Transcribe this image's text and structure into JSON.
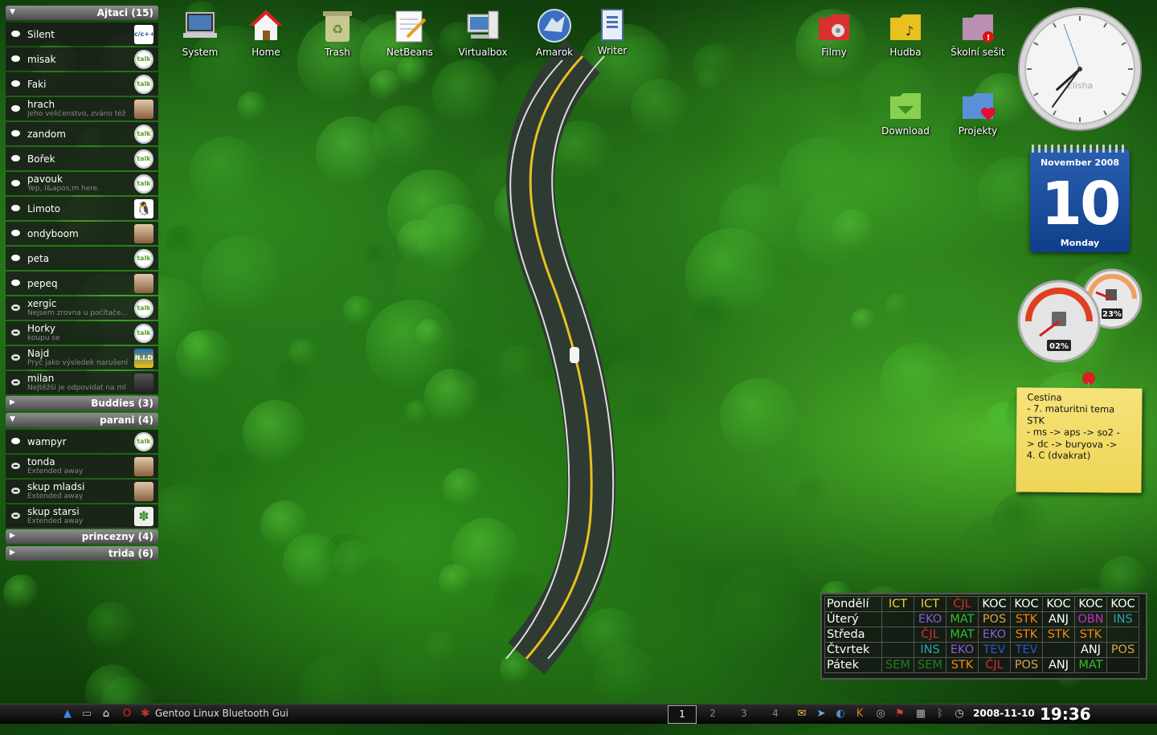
{
  "contacts": {
    "groups": [
      {
        "title": "Ajtaci (15)",
        "expanded": true,
        "contacts": [
          {
            "name": "Silent",
            "status_msg": "",
            "avatar": "c/c++",
            "away": false
          },
          {
            "name": "misak",
            "status_msg": "",
            "avatar": "talk",
            "away": false
          },
          {
            "name": "Faki",
            "status_msg": "",
            "avatar": "talk",
            "away": false
          },
          {
            "name": "hrach",
            "status_msg": "Jeho veličenstvo, zváno též",
            "avatar": "face",
            "away": false
          },
          {
            "name": "zandom",
            "status_msg": "",
            "avatar": "talk",
            "away": false
          },
          {
            "name": "Bořek",
            "status_msg": "",
            "avatar": "talk",
            "away": false
          },
          {
            "name": "pavouk",
            "status_msg": "Yep, I&apos;m here.",
            "avatar": "talk",
            "away": false
          },
          {
            "name": "Limoto",
            "status_msg": "",
            "avatar": "tux",
            "away": false
          },
          {
            "name": "ondyboom",
            "status_msg": "",
            "avatar": "face",
            "away": false
          },
          {
            "name": "peta",
            "status_msg": "",
            "avatar": "talk",
            "away": false
          },
          {
            "name": "pepeq",
            "status_msg": "",
            "avatar": "face",
            "away": false
          },
          {
            "name": "xergic",
            "status_msg": "Nejsem zrovna u počítače...",
            "avatar": "talk",
            "away": true
          },
          {
            "name": "Horky",
            "status_msg": "koupu se",
            "avatar": "talk",
            "away": true
          },
          {
            "name": "Najd",
            "status_msg": "Pryč jako výsledek narušení",
            "avatar": "N.I.D",
            "away": true
          },
          {
            "name": "milan",
            "status_msg": "Nejtěžší je odpovídat na ml",
            "avatar": "dark",
            "away": true
          }
        ]
      },
      {
        "title": "Buddies (3)",
        "expanded": false,
        "contacts": []
      },
      {
        "title": "parani (4)",
        "expanded": true,
        "contacts": [
          {
            "name": "wampyr",
            "status_msg": "",
            "avatar": "talk",
            "away": false
          },
          {
            "name": "tonda",
            "status_msg": "Extended away",
            "avatar": "face",
            "away": true
          },
          {
            "name": "skup mladsi",
            "status_msg": "Extended away",
            "avatar": "face",
            "away": true
          },
          {
            "name": "skup starsi",
            "status_msg": "Extended away",
            "avatar": "leaf",
            "away": true
          }
        ]
      },
      {
        "title": "princezny (4)",
        "expanded": false,
        "contacts": []
      },
      {
        "title": "trida (6)",
        "expanded": false,
        "contacts": []
      }
    ]
  },
  "desktop_icons": [
    {
      "label": "System",
      "icon": "laptop-icon"
    },
    {
      "label": "Home",
      "icon": "home-icon"
    },
    {
      "label": "Trash",
      "icon": "trash-icon"
    },
    {
      "label": "NetBeans",
      "icon": "notepad-icon"
    },
    {
      "label": "Virtualbox",
      "icon": "computer-icon"
    },
    {
      "label": "Amarok",
      "icon": "wolf-icon"
    },
    {
      "label": "Writer",
      "icon": "document-icon"
    },
    {
      "label": "Filmy",
      "icon": "film-folder-icon"
    },
    {
      "label": "Hudba",
      "icon": "music-folder-icon"
    },
    {
      "label": "Školní sešit",
      "icon": "alert-folder-icon"
    },
    {
      "label": "Download",
      "icon": "download-folder-icon"
    },
    {
      "label": "Projekty",
      "icon": "heart-folder-icon"
    }
  ],
  "clock": {
    "brand": "Elisha",
    "hours": 19,
    "minutes": 36
  },
  "calendar": {
    "month": "November 2008",
    "day": "10",
    "weekday": "Monday"
  },
  "gauges": {
    "cpu": "02%",
    "memory": "23%"
  },
  "note": {
    "text": "Cestina\n- 7. maturitni tema\nSTK\n- ms -> aps -> so2 -\n> dc -> buryova ->\n4. C (dvakrat)"
  },
  "timetable": {
    "rows": [
      {
        "day": "Pondělí",
        "slots": [
          [
            "ICT",
            "#e8d040"
          ],
          [
            "ICT",
            "#e8d040"
          ],
          [
            "ČJL",
            "#d03030"
          ],
          [
            "KOC",
            "#ffffff"
          ],
          [
            "KOC",
            "#ffffff"
          ],
          [
            "KOC",
            "#ffffff"
          ],
          [
            "KOC",
            "#ffffff"
          ],
          [
            "KOC",
            "#ffffff"
          ]
        ]
      },
      {
        "day": "Úterý",
        "slots": [
          [
            "",
            ""
          ],
          [
            "EKO",
            "#8a5ad8"
          ],
          [
            "MAT",
            "#30c030"
          ],
          [
            "POS",
            "#e0a050"
          ],
          [
            "STK",
            "#f08a10"
          ],
          [
            "ANJ",
            "#ffffff"
          ],
          [
            "OBN",
            "#c030c0"
          ],
          [
            "INS",
            "#2aa0b0"
          ]
        ]
      },
      {
        "day": "Středa",
        "slots": [
          [
            "",
            ""
          ],
          [
            "ČJL",
            "#d03030"
          ],
          [
            "MAT",
            "#30c030"
          ],
          [
            "EKO",
            "#8a5ad8"
          ],
          [
            "STK",
            "#f08a10"
          ],
          [
            "STK",
            "#f08a10"
          ],
          [
            "STK",
            "#f08a10"
          ],
          [
            "",
            ""
          ]
        ]
      },
      {
        "day": "Čtvrtek",
        "slots": [
          [
            "",
            ""
          ],
          [
            "INS",
            "#2aa0b0"
          ],
          [
            "EKO",
            "#8a5ad8"
          ],
          [
            "TEV",
            "#3050d0"
          ],
          [
            "TEV",
            "#3050d0"
          ],
          [
            "",
            ""
          ],
          [
            "ANJ",
            "#ffffff"
          ],
          [
            "POS",
            "#e0a050"
          ]
        ]
      },
      {
        "day": "Pátek",
        "slots": [
          [
            "SEM",
            "#208020"
          ],
          [
            "SEM",
            "#208020"
          ],
          [
            "STK",
            "#f08a10"
          ],
          [
            "ČJL",
            "#d03030"
          ],
          [
            "POS",
            "#e0a050"
          ],
          [
            "ANJ",
            "#ffffff"
          ],
          [
            "MAT",
            "#30c030"
          ],
          [
            "",
            ""
          ]
        ]
      }
    ]
  },
  "taskbar": {
    "window_title": "Gentoo Linux Bluetooth Gui",
    "desktops": [
      "1",
      "2",
      "3",
      "4"
    ],
    "active_desktop": "1",
    "date": "2008-11-10",
    "time": "19:36"
  }
}
